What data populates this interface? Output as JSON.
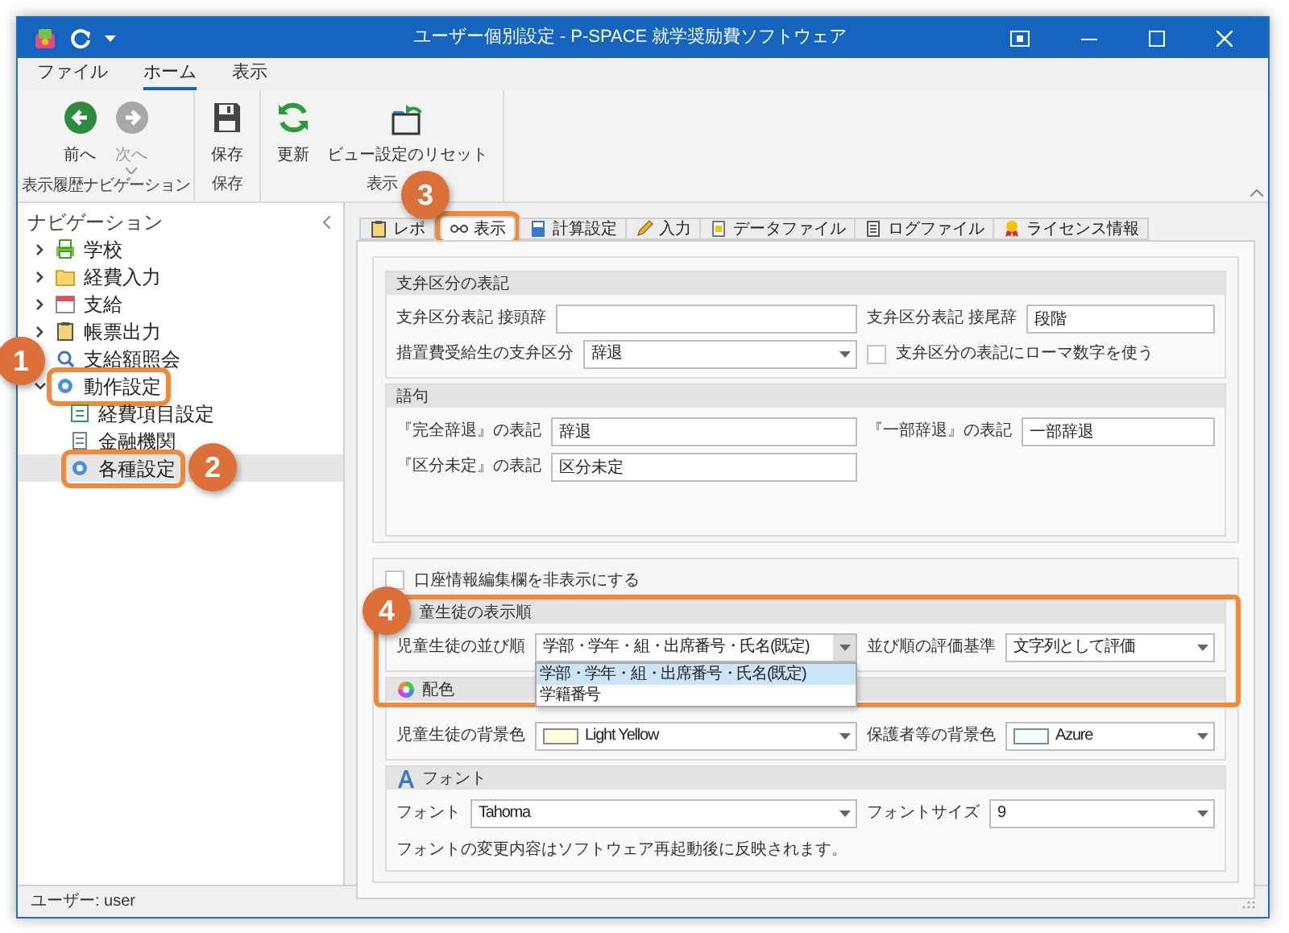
{
  "window": {
    "title": "ユーザー個別設定 - P-SPACE 就学奨励費ソフトウェア"
  },
  "ribbon": {
    "tabs": [
      {
        "label": "ファイル",
        "selected": false
      },
      {
        "label": "ホーム",
        "selected": true
      },
      {
        "label": "表示",
        "selected": false
      }
    ],
    "groups": [
      {
        "label": "表示履歴ナビゲーション",
        "buttons": [
          {
            "label": "前へ",
            "disabled": false
          },
          {
            "label": "次へ",
            "disabled": true
          }
        ]
      },
      {
        "label": "保存",
        "buttons": [
          {
            "label": "保存",
            "disabled": false
          }
        ]
      },
      {
        "label": "表示",
        "buttons": [
          {
            "label": "更新",
            "disabled": false
          },
          {
            "label": "ビュー設定のリセット",
            "disabled": false
          }
        ]
      }
    ]
  },
  "navigation": {
    "title": "ナビゲーション",
    "items": [
      {
        "label": "学校",
        "expanded": false,
        "selected": false
      },
      {
        "label": "経費入力",
        "expanded": false,
        "selected": false
      },
      {
        "label": "支給",
        "expanded": false,
        "selected": false
      },
      {
        "label": "帳票出力",
        "expanded": false,
        "selected": false
      },
      {
        "label": "支給額照会",
        "selected": false
      },
      {
        "label": "動作設定",
        "expanded": true,
        "selected": false,
        "highlighted": true,
        "children": [
          {
            "label": "経費項目設定",
            "selected": false
          },
          {
            "label": "金融機関",
            "selected": false
          },
          {
            "label": "各種設定",
            "selected": true,
            "highlighted": true
          }
        ]
      }
    ]
  },
  "settings": {
    "tabs": [
      {
        "label": "レポ",
        "selected": false
      },
      {
        "label": "表示",
        "selected": true,
        "highlighted": true
      },
      {
        "label": "計算設定",
        "selected": false
      },
      {
        "label": "入力",
        "selected": false
      },
      {
        "label": "データファイル",
        "selected": false
      },
      {
        "label": "ログファイル",
        "selected": false
      },
      {
        "label": "ライセンス情報",
        "selected": false
      }
    ],
    "panels": [
      {
        "groups": [
          {
            "title": "支弁区分の表記",
            "rows": [
              [
                {
                  "kind": "text",
                  "label": "支弁区分表記 接頭辞"
                },
                {
                  "kind": "text",
                  "label": "支弁区分表記 接尾辞",
                  "value": "段階"
                }
              ],
              [
                {
                  "kind": "select",
                  "label": "措置費受給生の支弁区分",
                  "value": "辞退",
                  "open": false
                },
                {
                  "kind": "checkbox",
                  "label": "支弁区分の表記にローマ数字を使う",
                  "checked": false
                }
              ]
            ]
          },
          {
            "title": "語句",
            "rows": [
              [
                {
                  "kind": "text",
                  "label": "『完全辞退』の表記",
                  "value": "辞退"
                },
                {
                  "kind": "text",
                  "label": "『一部辞退』の表記",
                  "value": "一部辞退"
                }
              ],
              [
                {
                  "kind": "text",
                  "label": "『区分未定』の表記",
                  "value": "区分未定"
                }
              ]
            ]
          }
        ]
      },
      {
        "checkbox": {
          "label": "口座情報編集欄を非表示にする",
          "checked": false
        },
        "groups": [
          {
            "title": "童生徒の表示順",
            "rows": [
              [
                {
                  "kind": "select",
                  "label": "児童生徒の並び順",
                  "value": "学部・学年・組・出席番号・氏名(既定)",
                  "open": true,
                  "options": [
                    {
                      "label": "学部・学年・組・出席番号・氏名(既定)",
                      "selected": true
                    },
                    {
                      "label": "学籍番号",
                      "selected": false
                    }
                  ]
                },
                {
                  "kind": "select",
                  "label": "並び順の評価基準",
                  "value": "文字列として評価",
                  "open": false
                }
              ]
            ]
          },
          {
            "title": "配色",
            "rows": [
              [
                {
                  "kind": "select",
                  "label": "児童生徒の背景色",
                  "value": "Light Yellow",
                  "color": "#ffffe0",
                  "open": false
                },
                {
                  "kind": "select",
                  "label": "保護者等の背景色",
                  "value": "Azure",
                  "color": "#f0ffff",
                  "open": false
                }
              ]
            ]
          },
          {
            "title": "フォント",
            "rows": [
              [
                {
                  "kind": "select",
                  "label": "フォント",
                  "value": "Tahoma",
                  "open": false
                },
                {
                  "kind": "select",
                  "label": "フォントサイズ",
                  "value": "9",
                  "open": false
                }
              ]
            ],
            "note": "フォントの変更内容はソフトウェア再起動後に反映されます。"
          }
        ]
      }
    ]
  },
  "status_bar": {
    "text": "ユーザー: user"
  },
  "callouts": [
    {
      "number": "1"
    },
    {
      "number": "2"
    },
    {
      "number": "3"
    },
    {
      "number": "4"
    }
  ]
}
